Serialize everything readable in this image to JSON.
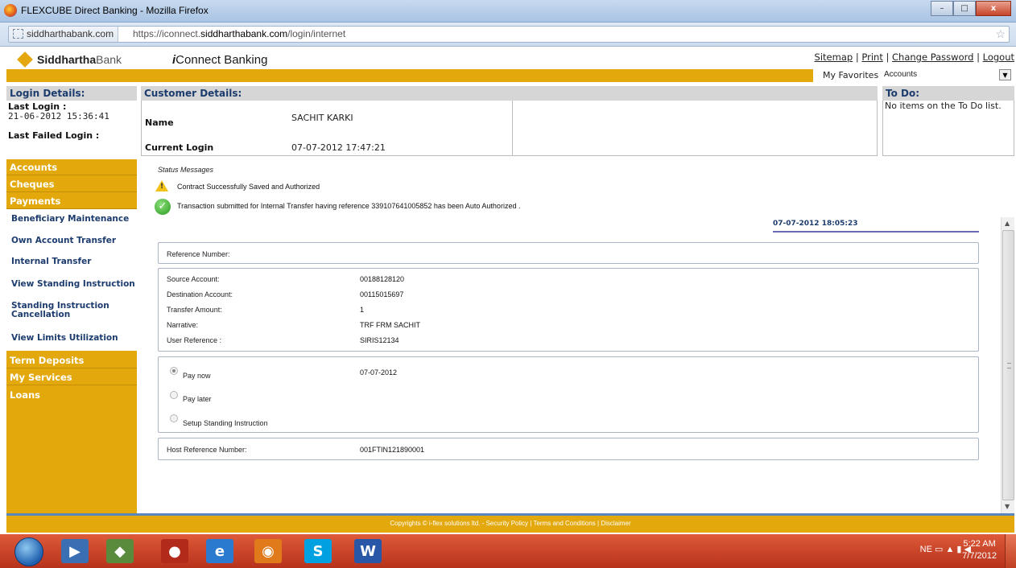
{
  "window": {
    "title": "FLEXCUBE Direct Banking - Mozilla Firefox",
    "minimize": "–",
    "maximize": "□",
    "close": "x"
  },
  "address": {
    "site_id": "siddharthabank.com",
    "url_prefix": "https://iconnect.",
    "url_domain": "siddharthabank.com",
    "url_path": "/login/internet"
  },
  "bank": {
    "logo_bold": "Siddhartha",
    "logo_light": "Bank",
    "app_title_i": "i",
    "app_title_rest": "Connect Banking",
    "links": [
      "Sitemap",
      "Print",
      "Change Password",
      "Logout"
    ],
    "favorites_label": "My Favorites",
    "favorites_selected": "Accounts"
  },
  "login": {
    "header": "Login Details:",
    "last_login_label": "Last Login :",
    "last_login_value": "21-06-2012 15:36:41",
    "last_failed_label": "Last Failed Login :"
  },
  "customer": {
    "header": "Customer Details:",
    "name_label": "Name",
    "name_value": "SACHIT KARKI",
    "current_login_label": "Current Login",
    "current_login_value": "07-07-2012 17:47:21"
  },
  "todo": {
    "header": "To Do:",
    "message": "No items on the To Do list."
  },
  "sidebar": {
    "categories_top": [
      "Accounts",
      "Cheques",
      "Payments"
    ],
    "items": [
      "Beneficiary Maintenance",
      "Own Account Transfer",
      "Internal Transfer",
      "View Standing Instruction",
      "Standing Instruction Cancellation",
      "View Limits Utilization"
    ],
    "categories_bottom": [
      "Term Deposits",
      "My Services",
      "Loans"
    ]
  },
  "status": {
    "title": "Status Messages",
    "warning": "Contract Successfully Saved and Authorized",
    "success": "Transaction submitted for Internal Transfer having reference 339107641005852 has been Auto Authorized ."
  },
  "transaction": {
    "timestamp": "07-07-2012 18:05:23",
    "reference_label": "Reference Number:",
    "details": [
      {
        "label": "Source Account:",
        "value": "00188128120"
      },
      {
        "label": "Destination Account:",
        "value": "00115015697"
      },
      {
        "label": "Transfer Amount:",
        "value": "1"
      },
      {
        "label": "Narrative:",
        "value": "TRF FRM SACHIT"
      },
      {
        "label": "User Reference :",
        "value": "SIRIS12134"
      }
    ],
    "pay_options": [
      "Pay now",
      "Pay later",
      "Setup Standing Instruction"
    ],
    "pay_selected": "Pay now",
    "pay_date": "07-07-2012",
    "host_ref_label": "Host Reference Number:",
    "host_ref_value": "001FTIN121890001"
  },
  "footer": {
    "text": "Copyrights © i-flex solutions ltd. - Security Policy | Terms and Conditions | Disclaimer"
  },
  "taskbar": {
    "language": "NE",
    "time": "5:22 AM",
    "date": "7/7/2012"
  },
  "colors": {
    "accent_gold": "#e2a80c",
    "header_navy": "#1d3c6e",
    "taskbar_red": "#c1402a"
  }
}
